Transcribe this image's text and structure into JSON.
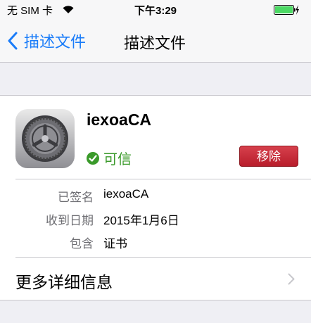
{
  "status_bar": {
    "carrier": "无 SIM 卡",
    "time": "下午3:29",
    "wifi_icon": "wifi-icon",
    "battery_icon": "battery-charging-icon",
    "battery_color": "#4cd964"
  },
  "nav": {
    "back_label": "描述文件",
    "title": "描述文件",
    "accent_color": "#1a7cf9"
  },
  "profile": {
    "icon": "settings-gear-icon",
    "name": "iexoaCA",
    "trust_label": "可信",
    "trust_color": "#3a9a2a",
    "remove_label": "移除",
    "remove_color": "#c4232f"
  },
  "details": [
    {
      "label": "已签名",
      "value": "iexoaCA"
    },
    {
      "label": "收到日期",
      "value": "2015年1月6日"
    },
    {
      "label": "包含",
      "value": "证书"
    }
  ],
  "more": {
    "label": "更多详细信息",
    "chevron_icon": "chevron-right-icon"
  }
}
